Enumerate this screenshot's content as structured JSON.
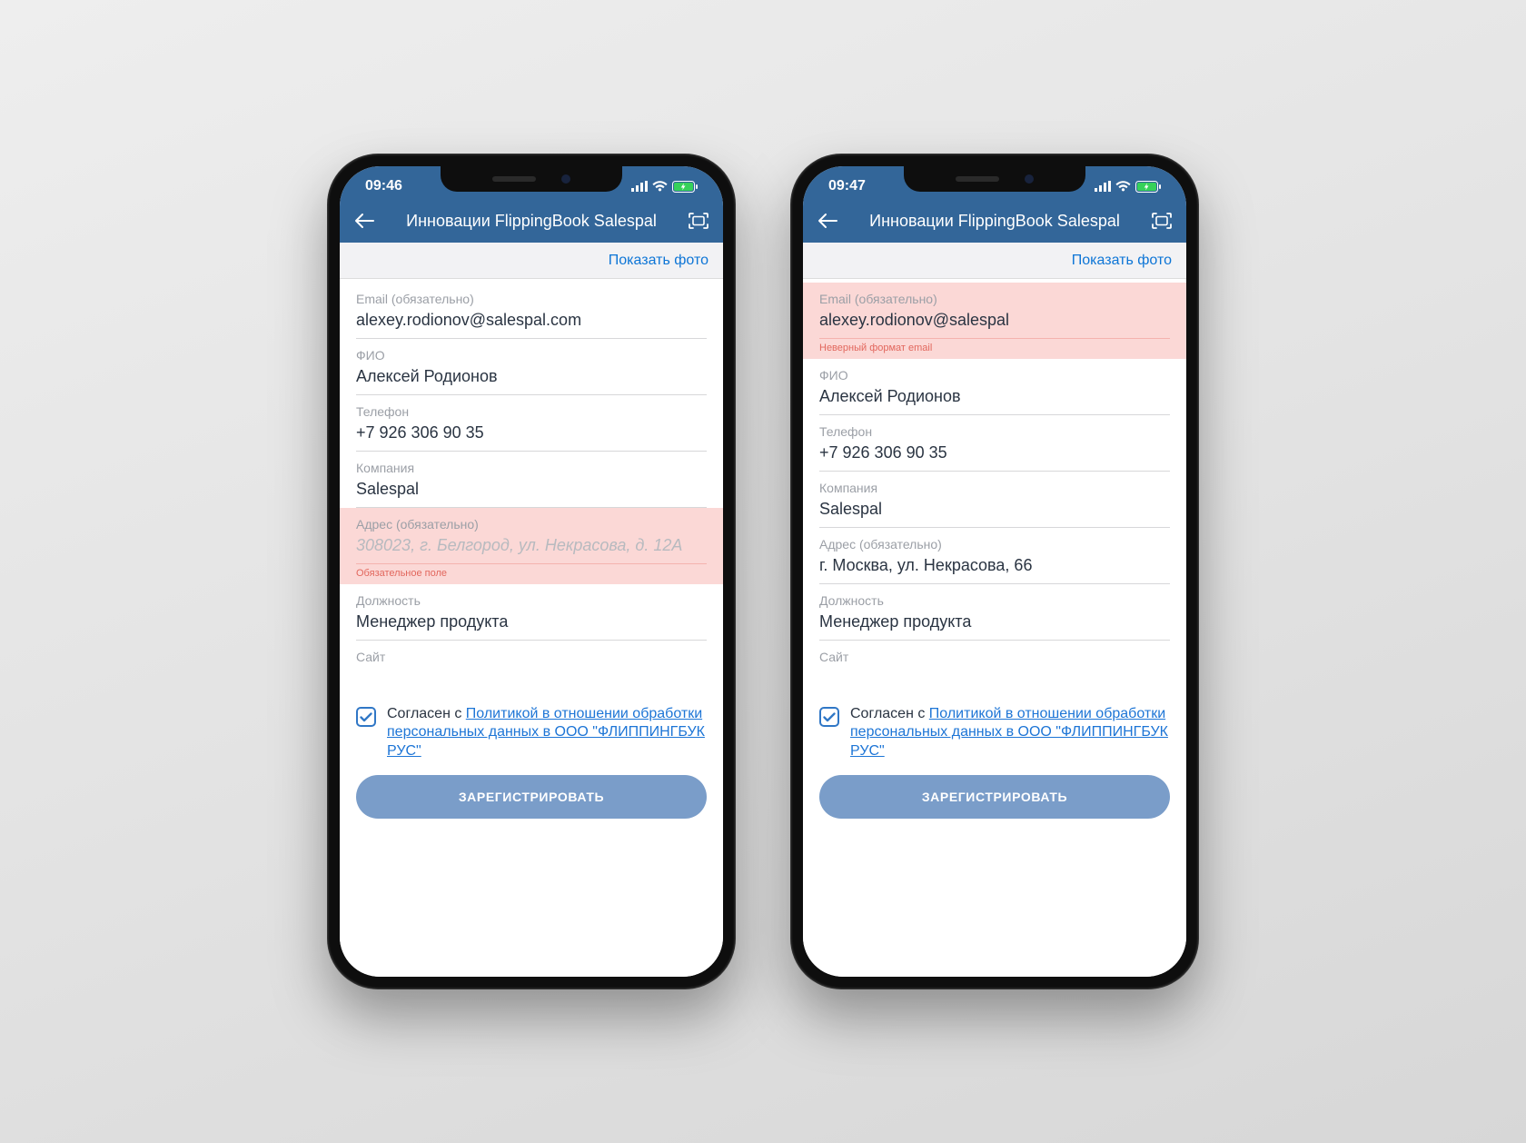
{
  "phones": [
    {
      "status_time": "09:46",
      "nav_title": "Инновации FlippingBook Salespal",
      "subbar_link": "Показать фото",
      "fields": [
        {
          "label": "Email (обязательно)",
          "value": "alexey.rodionov@salespal.com",
          "error": false
        },
        {
          "label": "ФИО",
          "value": "Алексей Родионов",
          "error": false
        },
        {
          "label": "Телефон",
          "value": "+7 926 306 90 35",
          "error": false
        },
        {
          "label": "Компания",
          "value": "Salespal",
          "error": false
        },
        {
          "label": "Адрес (обязательно)",
          "value": "",
          "placeholder": "308023, г. Белгород, ул. Некрасова, д. 12А",
          "error": true,
          "error_msg": "Обязательное поле"
        },
        {
          "label": "Должность",
          "value": "Менеджер продукта",
          "error": false
        },
        {
          "label": "Сайт",
          "value": "",
          "error": false
        }
      ],
      "consent_prefix": "Согласен с ",
      "consent_link": "Политикой в отношении обработки персональных данных в ООО \"ФЛИППИНГБУК РУС\"",
      "submit": "ЗАРЕГИСТРИРОВАТЬ"
    },
    {
      "status_time": "09:47",
      "nav_title": "Инновации FlippingBook Salespal",
      "subbar_link": "Показать фото",
      "fields": [
        {
          "label": "Email (обязательно)",
          "value": "alexey.rodionov@salespal",
          "error": true,
          "error_msg": "Неверный формат email"
        },
        {
          "label": "ФИО",
          "value": "Алексей Родионов",
          "error": false
        },
        {
          "label": "Телефон",
          "value": "+7 926 306 90 35",
          "error": false
        },
        {
          "label": "Компания",
          "value": "Salespal",
          "error": false
        },
        {
          "label": "Адрес (обязательно)",
          "value": "г. Москва, ул. Некрасова, 66",
          "error": false
        },
        {
          "label": "Должность",
          "value": "Менеджер продукта",
          "error": false
        },
        {
          "label": "Сайт",
          "value": "",
          "error": false
        }
      ],
      "consent_prefix": "Согласен с ",
      "consent_link": "Политикой в отношении обработки персональных данных в ООО \"ФЛИППИНГБУК РУС\"",
      "submit": "ЗАРЕГИСТРИРОВАТЬ"
    }
  ]
}
